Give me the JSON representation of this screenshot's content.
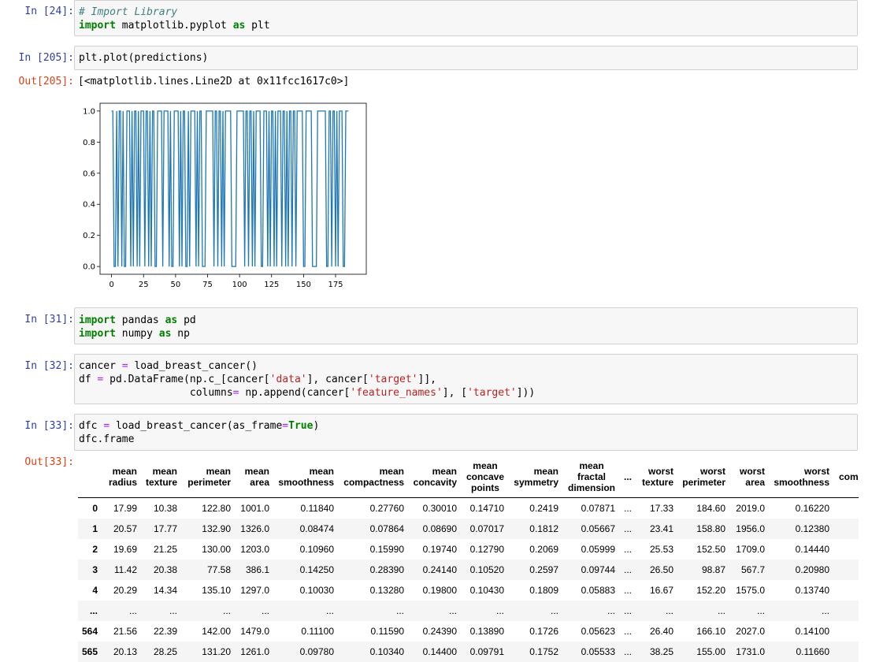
{
  "cells": [
    {
      "prompt": "In [24]:",
      "lines": [
        "# Import Library",
        "import matplotlib.pyplot as plt"
      ]
    },
    {
      "prompt": "In [205]:",
      "lines": [
        "plt.plot(predictions)"
      ],
      "out_prompt": "Out[205]:",
      "output": "[<matplotlib.lines.Line2D at 0x11fcc1617c0>]"
    },
    {
      "prompt": "In [31]:",
      "lines": [
        "import pandas as pd",
        "import numpy as np"
      ]
    },
    {
      "prompt": "In [32]:",
      "lines": [
        "cancer = load_breast_cancer()",
        "df = pd.DataFrame(np.c_[cancer['data'], cancer['target']],",
        "                  columns= np.append(cancer['feature_names'], ['target']))"
      ]
    },
    {
      "prompt": "In [33]:",
      "lines": [
        "dfc = load_breast_cancer(as_frame=True)",
        "dfc.frame"
      ],
      "out_prompt": "Out[33]:"
    }
  ],
  "chart_data": {
    "type": "line",
    "title": "",
    "xlabel": "",
    "ylabel": "",
    "xlim": [
      -9,
      199
    ],
    "ylim": [
      -0.05,
      1.05
    ],
    "xticks": [
      "0",
      "25",
      "50",
      "75",
      "100",
      "125",
      "150",
      "175"
    ],
    "xtick_values": [
      0,
      25,
      50,
      75,
      100,
      125,
      150,
      175
    ],
    "yticks": [
      "0.0",
      "0.2",
      "0.4",
      "0.6",
      "0.8",
      "1.0"
    ],
    "ytick_values": [
      0,
      0.2,
      0.4,
      0.6,
      0.8,
      1.0
    ],
    "line_color": "#1f77b4",
    "series": [
      {
        "values": [
          1,
          1,
          0,
          0,
          1,
          0,
          1,
          1,
          0,
          1,
          0,
          0,
          1,
          1,
          1,
          0,
          1,
          0,
          1,
          1,
          0,
          1,
          0,
          1,
          1,
          1,
          0,
          1,
          1,
          0,
          1,
          0,
          1,
          1,
          0,
          0,
          1,
          1,
          1,
          1,
          0,
          1,
          1,
          1,
          1,
          0,
          1,
          0,
          0,
          1,
          1,
          1,
          1,
          0,
          1,
          0,
          1,
          1,
          0,
          0,
          1,
          0,
          1,
          1,
          1,
          1,
          0,
          1,
          0,
          1,
          1,
          0,
          0,
          0,
          1,
          1,
          1,
          1,
          1,
          1,
          0,
          1,
          1,
          0,
          1,
          1,
          0,
          1,
          0,
          1,
          1,
          1,
          1,
          1,
          0,
          0,
          0,
          0,
          1,
          1,
          1,
          1,
          1,
          1,
          0,
          1,
          1,
          0,
          1,
          1,
          0,
          1,
          0,
          1,
          1,
          1,
          1,
          0,
          0,
          1,
          1,
          1,
          0,
          1,
          0,
          1,
          1,
          0,
          1,
          0,
          1,
          1,
          1,
          0,
          1,
          1,
          0,
          1,
          0,
          1,
          1,
          0,
          1,
          1,
          0,
          1,
          1,
          1,
          1,
          1,
          0,
          0,
          1,
          1,
          1,
          1,
          1,
          0,
          0,
          0,
          0,
          1,
          1,
          1,
          1,
          1,
          1,
          1,
          0,
          0,
          1,
          1,
          0,
          1,
          1,
          0,
          1,
          0,
          1,
          1,
          1,
          0,
          0,
          1,
          1,
          1
        ]
      }
    ]
  },
  "table": {
    "headers": [
      [
        "mean",
        "radius"
      ],
      [
        "mean",
        "texture"
      ],
      [
        "mean",
        "perimeter"
      ],
      [
        "mean",
        "area"
      ],
      [
        "mean",
        "smoothness"
      ],
      [
        "mean",
        "compactness"
      ],
      [
        "mean",
        "concavity"
      ],
      [
        "mean",
        "concave",
        "points"
      ],
      [
        "mean",
        "symmetry"
      ],
      [
        "mean",
        "fractal",
        "dimension"
      ],
      [
        "..."
      ],
      [
        "worst",
        "texture"
      ],
      [
        "worst",
        "perimeter"
      ],
      [
        "worst",
        "area"
      ],
      [
        "worst",
        "smoothness"
      ],
      [
        "com"
      ]
    ],
    "rows": [
      [
        "0",
        "17.99",
        "10.38",
        "122.80",
        "1001.0",
        "0.11840",
        "0.27760",
        "0.30010",
        "0.14710",
        "0.2419",
        "0.07871",
        "...",
        "17.33",
        "184.60",
        "2019.0",
        "0.16220"
      ],
      [
        "1",
        "20.57",
        "17.77",
        "132.90",
        "1326.0",
        "0.08474",
        "0.07864",
        "0.08690",
        "0.07017",
        "0.1812",
        "0.05667",
        "...",
        "23.41",
        "158.80",
        "1956.0",
        "0.12380"
      ],
      [
        "2",
        "19.69",
        "21.25",
        "130.00",
        "1203.0",
        "0.10960",
        "0.15990",
        "0.19740",
        "0.12790",
        "0.2069",
        "0.05999",
        "...",
        "25.53",
        "152.50",
        "1709.0",
        "0.14440"
      ],
      [
        "3",
        "11.42",
        "20.38",
        "77.58",
        "386.1",
        "0.14250",
        "0.28390",
        "0.24140",
        "0.10520",
        "0.2597",
        "0.09744",
        "...",
        "26.50",
        "98.87",
        "567.7",
        "0.20980"
      ],
      [
        "4",
        "20.29",
        "14.34",
        "135.10",
        "1297.0",
        "0.10030",
        "0.13280",
        "0.19800",
        "0.10430",
        "0.1809",
        "0.05883",
        "...",
        "16.67",
        "152.20",
        "1575.0",
        "0.13740"
      ],
      [
        "...",
        "...",
        "...",
        "...",
        "...",
        "...",
        "...",
        "...",
        "...",
        "...",
        "...",
        "...",
        "...",
        "...",
        "...",
        "..."
      ],
      [
        "564",
        "21.56",
        "22.39",
        "142.00",
        "1479.0",
        "0.11100",
        "0.11590",
        "0.24390",
        "0.13890",
        "0.1726",
        "0.05623",
        "...",
        "26.40",
        "166.10",
        "2027.0",
        "0.14100"
      ],
      [
        "565",
        "20.13",
        "28.25",
        "131.20",
        "1261.0",
        "0.09780",
        "0.10340",
        "0.14400",
        "0.09791",
        "0.1752",
        "0.05533",
        "...",
        "38.25",
        "155.00",
        "1731.0",
        "0.11660"
      ]
    ]
  }
}
